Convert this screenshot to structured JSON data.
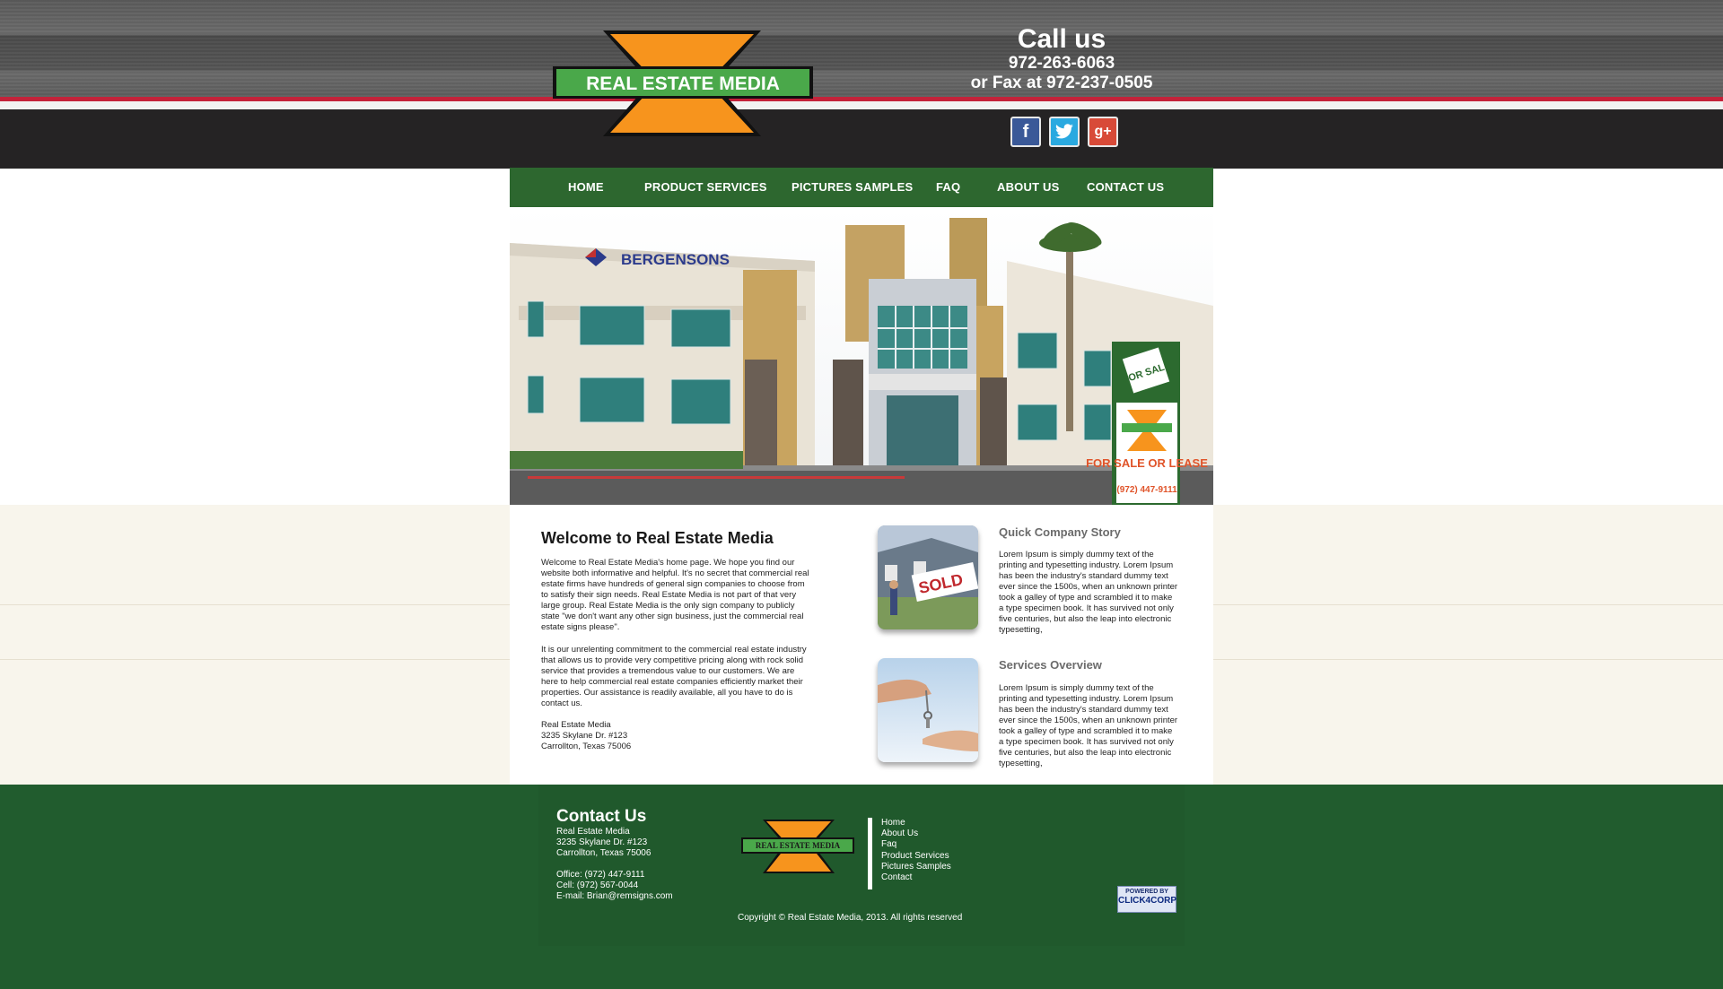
{
  "header": {
    "logo_text": "REAL ESTATE MEDIA",
    "call_title": "Call us",
    "call_phone": "972-263-6063",
    "call_fax": "or Fax at 972-237-0505",
    "social": [
      "facebook-icon",
      "twitter-icon",
      "google-plus-icon"
    ]
  },
  "nav": {
    "items": [
      {
        "label": "HOME"
      },
      {
        "label": "PRODUCT SERVICES"
      },
      {
        "label": "PICTURES SAMPLES"
      },
      {
        "label": "FAQ"
      },
      {
        "label": "ABOUT US"
      },
      {
        "label": "CONTACT US"
      }
    ]
  },
  "hero": {
    "building_sign": "BERGENSONS",
    "sign_for_sale": "FOR SALE",
    "sign_lease": "FOR SALE OR LEASE",
    "sign_phone": "(972) 447-9111"
  },
  "welcome": {
    "title": "Welcome to Real Estate Media",
    "p1": "Welcome to Real Estate Media's home page. We hope you find our website both informative and helpful. It's no secret that commercial real estate firms have hundreds of general sign companies to choose from to satisfy their sign needs. Real Estate Media is not part of that very large group. Real Estate Media is the only sign company to publicly state \"we don't want any other sign business, just the commercial real estate signs please\".",
    "p2": "It is our unrelenting commitment to the commercial real estate industry that allows us to provide very competitive pricing along with rock solid service that provides a tremendous value to our customers. We are here to help commercial real estate companies efficiently market their properties. Our assistance is readily available, all you have to do is contact us.",
    "address": [
      "Real Estate Media",
      "3235 Skylane Dr. #123",
      "Carrollton, Texas 75006"
    ]
  },
  "story": {
    "title": "Quick Company Story",
    "text": "Lorem Ipsum is simply dummy text of the printing and typesetting industry. Lorem Ipsum has been the industry's standard dummy text ever since the 1500s, when an unknown printer took a galley of type and scrambled it to make a type specimen book. It has survived not only five centuries, but also the leap into electronic typesetting,",
    "thumb_sign": "SOLD"
  },
  "services": {
    "title": "Services Overview",
    "text": "Lorem Ipsum is simply dummy text of the printing and typesetting industry. Lorem Ipsum has been the industry's standard dummy text ever since the 1500s, when an unknown printer took a galley of type and scrambled it to make a type specimen book. It has survived not only five centuries, but also the leap into electronic typesetting,"
  },
  "footer": {
    "contact_title": "Contact Us",
    "contact_lines": [
      "Real Estate Media",
      "3235 Skylane Dr. #123",
      "Carrollton, Texas 75006"
    ],
    "phone_lines": [
      "Office: (972) 447-9111",
      "Cell: (972) 567-0044",
      "E-mail: Brian@remsigns.com"
    ],
    "logo_text": "REAL ESTATE MEDIA",
    "links": [
      {
        "label": "Home"
      },
      {
        "label": "About Us"
      },
      {
        "label": "Faq"
      },
      {
        "label": "Product Services"
      },
      {
        "label": "Pictures Samples"
      },
      {
        "label": "Contact"
      }
    ],
    "copyright": "Copyright © Real Estate Media, 2013. All rights reserved",
    "powered_line1": "POWERED BY",
    "powered_line2": "CLICK4CORP"
  },
  "colors": {
    "nav_green": "#2d672f",
    "footer_green": "#215c2e",
    "logo_orange": "#f7941d",
    "logo_green": "#4aa84a",
    "accent_red": "#c4223a"
  }
}
